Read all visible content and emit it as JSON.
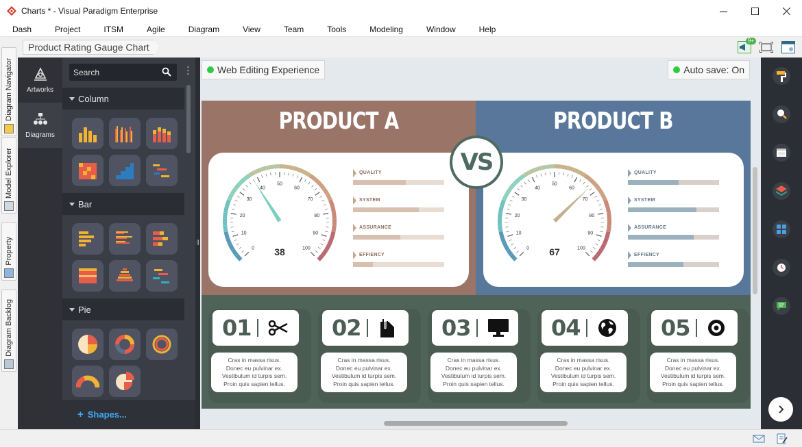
{
  "window": {
    "title": "Charts * - Visual Paradigm Enterprise",
    "controls": [
      "minimize",
      "maximize",
      "close"
    ]
  },
  "menu": [
    "Dash",
    "Project",
    "ITSM",
    "Agile",
    "Diagram",
    "View",
    "Team",
    "Tools",
    "Modeling",
    "Window",
    "Help"
  ],
  "side_tabs": [
    "Diagram Navigator",
    "Model Explorer",
    "Property",
    "Diagram Backlog"
  ],
  "breadcrumb": "Product Rating Gauge Chart",
  "notification_badge": "9+",
  "left_nav": [
    {
      "label": "Artworks",
      "icon": "artworks-icon",
      "active": false
    },
    {
      "label": "Diagrams",
      "icon": "diagrams-icon",
      "active": true
    }
  ],
  "search": {
    "placeholder": "Search"
  },
  "categories": [
    {
      "name": "Column",
      "count": 6
    },
    {
      "name": "Bar",
      "count": 6
    },
    {
      "name": "Pie",
      "count": 5
    }
  ],
  "shapes_link": "Shapes...",
  "status": {
    "web_editing": "Web Editing Experience",
    "auto_save": "Auto save: On",
    "indicator_color": "#2ecc40"
  },
  "infographic": {
    "vs": "VS",
    "products": [
      {
        "title": "PRODUCT A",
        "gauge_value": "38",
        "ticks": [
          "0",
          "10",
          "20",
          "30",
          "40",
          "50",
          "60",
          "70",
          "80",
          "90",
          "100"
        ],
        "metrics": [
          {
            "label": "QUALITY",
            "value": 0.58
          },
          {
            "label": "SYSTEM",
            "value": 0.72
          },
          {
            "label": "ASSURANCE",
            "value": 0.52
          },
          {
            "label": "EFFIENCY",
            "value": 0.22
          }
        ],
        "bg_color": "#9a7466",
        "bar_color": "#d8bfb0",
        "track_color": "#e8dcd3"
      },
      {
        "title": "PRODUCT B",
        "gauge_value": "67",
        "ticks": [
          "0",
          "10",
          "20",
          "30",
          "40",
          "50",
          "60",
          "70",
          "80",
          "90",
          "100"
        ],
        "metrics": [
          {
            "label": "QUALITY",
            "value": 0.56
          },
          {
            "label": "SYSTEM",
            "value": 0.75
          },
          {
            "label": "ASSURANCE",
            "value": 0.72
          },
          {
            "label": "EFFIENCY",
            "value": 0.61
          }
        ],
        "bg_color": "#58779a",
        "bar_color": "#9bb1bd",
        "track_color": "#d9d0cc"
      }
    ],
    "steps": [
      {
        "num": "01",
        "icon": "scissors-icon",
        "text": [
          "Cras in massa risus.",
          "Donec eu pulvinar ex.",
          "Vestibulum id turpis sem.",
          "Proin quis sapien tellus."
        ]
      },
      {
        "num": "02",
        "icon": "document-clip-icon",
        "text": [
          "Cras in massa risus.",
          "Donec eu pulvinar ex.",
          "Vestibulum id turpis sem.",
          "Proin quis sapien tellus."
        ]
      },
      {
        "num": "03",
        "icon": "monitor-icon",
        "text": [
          "Cras in massa risus.",
          "Donec eu pulvinar ex.",
          "Vestibulum id turpis sem.",
          "Proin quis sapien tellus."
        ]
      },
      {
        "num": "04",
        "icon": "globe-icon",
        "text": [
          "Cras in massa risus.",
          "Donec eu pulvinar ex.",
          "Vestibulum id turpis sem.",
          "Proin quis sapien tellus."
        ]
      },
      {
        "num": "05",
        "icon": "target-icon",
        "text": [
          "Cras in massa risus.",
          "Donec eu pulvinar ex.",
          "Vestibulum id turpis sem.",
          "Proin quis sapien tellus."
        ]
      }
    ]
  },
  "right_toolbar": [
    "paint-format-icon",
    "search-zoom-icon",
    "window-icon",
    "layers-icon",
    "grid-icon",
    "history-icon",
    "comment-icon",
    "next-arrow-icon"
  ]
}
